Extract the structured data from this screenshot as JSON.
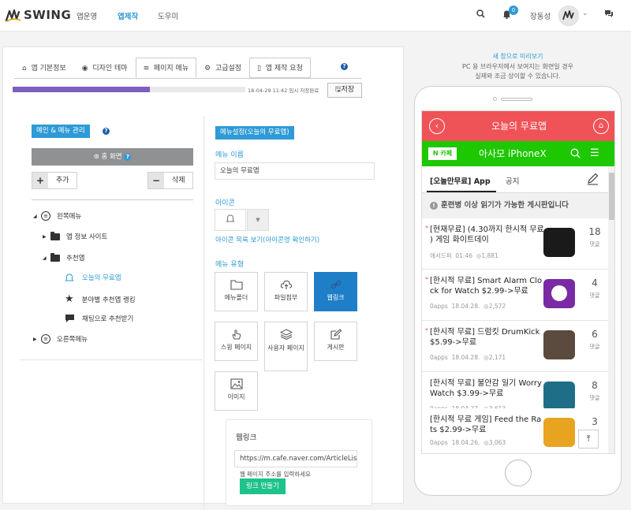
{
  "app": {
    "name": "SWING"
  },
  "nav": {
    "items": [
      "앱운영",
      "앱제작",
      "도우미"
    ],
    "active_index": 1
  },
  "header": {
    "notification_count": "0",
    "user_name": "장동성"
  },
  "tabs": [
    {
      "label": "앱 기본정보",
      "icon": "home-icon"
    },
    {
      "label": "디자인 테마",
      "icon": "eye-icon"
    },
    {
      "label": "페이지 메뉴",
      "icon": "menu-icon",
      "active": true
    },
    {
      "label": "고급설정",
      "icon": "gears-icon"
    },
    {
      "label": "앱 제작 요청",
      "icon": "mobile-icon"
    }
  ],
  "progress": {
    "percent": 59,
    "saved_text": "18-04-29 11:42 임시 저장완료",
    "save_label": "저장",
    "bar_color": "#7c5fbf"
  },
  "menu_panel": {
    "title": "메인 & 메뉴 관리",
    "home_label": "홈 화면",
    "add_label": "추가",
    "delete_label": "삭제",
    "tree": [
      {
        "label": "왼쪽메뉴",
        "level": 0
      },
      {
        "label": "앱 정보 사이트",
        "level": 1
      },
      {
        "label": "추천앱",
        "level": 1
      },
      {
        "label": "오늘의 무료앱",
        "level": 2,
        "selected": true
      },
      {
        "label": "분야별 추천앱 랭킹",
        "level": 2
      },
      {
        "label": "채팅으로 추천받기",
        "level": 2
      },
      {
        "label": "오른쪽메뉴",
        "level": 0
      }
    ]
  },
  "settings": {
    "title": "메뉴설정(오늘의 무료앱)",
    "menu_name_label": "메뉴 이름",
    "menu_name_value": "오늘의 무료앱",
    "icon_label": "아이콘",
    "icon_link": "아이콘 목록 보기(아이콘명 확인하기)",
    "menu_type_label": "메뉴 유형",
    "menu_types": [
      "메뉴폴더",
      "파일첨부",
      "웹링크",
      "스윙 페이지",
      "사용자 페이지",
      "게시판",
      "이미지"
    ],
    "selected_type": "웹링크",
    "weblink": {
      "title": "웹링크",
      "url_value": "https://m.cafe.naver.com/ArticleLis",
      "hint": "웹 페이지 주소를 입력하세요",
      "button_label": "링크 만들기"
    }
  },
  "preview": {
    "new_window_label": "새 창으로 미리보기",
    "caption_line1": "PC 용 브라우저에서 보여지는 화면일 경우",
    "caption_line2": "실제와 조금 상이할 수 있습니다.",
    "app_title": "오늘의 무료앱",
    "cafe_badge": "N 카페",
    "cafe_title": "아사모 iPhoneX",
    "cafe_tab_active": "[오늘만무료] App",
    "cafe_tab_other": "공지",
    "notice": "훈련병 이상 읽기가 가능한 게시판입니다",
    "posts": [
      {
        "title": "[현재무료] (4.30까지 한시적 무료 ) 게임 화이트데이",
        "author": "애서드퍼",
        "date": "01:46",
        "views": "1,881",
        "count": "18",
        "count_label": "댓글",
        "starred": true
      },
      {
        "title": "[한시적 무료] Smart Alarm Clock for Watch $2.99->무료",
        "author": "0apps",
        "date": "18.04.28.",
        "views": "2,572",
        "count": "4",
        "count_label": "댓글",
        "starred": true
      },
      {
        "title": "[한시적 무료] 드럼킷 DrumKick $5.99->무료",
        "author": "0apps",
        "date": "18.04.28.",
        "views": "2,171",
        "count": "6",
        "count_label": "댓글",
        "starred": true
      },
      {
        "title": "[한시적 무료] 불안감 일기 Worry Watch $3.99->무료",
        "author": "0apps",
        "date": "18.04.27.",
        "views": "3,613",
        "count": "8",
        "count_label": "댓글",
        "starred": false
      },
      {
        "title": "[한시적 무료 게임] Feed the Rats $2.99->무료",
        "author": "0apps",
        "date": "18.04.26.",
        "views": "3,063",
        "count": "3",
        "count_label": "",
        "starred": false
      }
    ]
  },
  "colors": {
    "accent": "#2e9bd6",
    "red": "#ef5358",
    "green": "#1ec800",
    "selected": "#1e7fc8"
  }
}
